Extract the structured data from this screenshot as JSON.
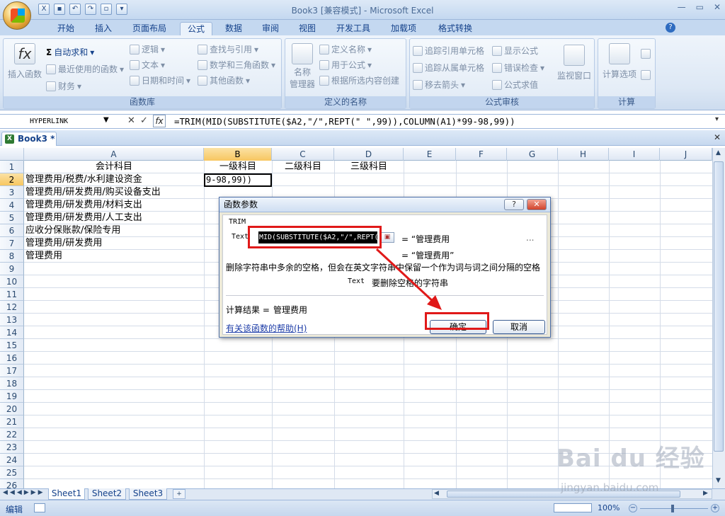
{
  "window": {
    "title": "Book3  [兼容模式] - Microsoft Excel",
    "controls": [
      "—",
      "▭",
      "✕"
    ]
  },
  "ribbon_tabs": [
    "开始",
    "插入",
    "页面布局",
    "公式",
    "数据",
    "审阅",
    "视图",
    "开发工具",
    "加载项",
    "格式转换"
  ],
  "active_tab": "公式",
  "groups": {
    "library": {
      "label": "函数库",
      "insert_function": "插入函数",
      "autosum": "自动求和",
      "recent": "最近使用的函数",
      "finance": "财务",
      "logic": "逻辑",
      "text": "文本",
      "datetime": "日期和时间",
      "lookup": "查找与引用",
      "math": "数学和三角函数",
      "other": "其他函数"
    },
    "names": {
      "label": "定义的名称",
      "manager_line1": "名称",
      "manager_line2": "管理器",
      "define_name": "定义名称",
      "use_in_formula": "用于公式",
      "create_from_selection": "根据所选内容创建"
    },
    "audit": {
      "label": "公式审核",
      "trace_precedents": "追踪引用单元格",
      "trace_dependents": "追踪从属单元格",
      "remove_arrows": "移去箭头",
      "show_formulas": "显示公式",
      "error_check": "错误检查",
      "evaluate": "公式求值",
      "watch_window": "监视窗口"
    },
    "calc": {
      "label": "计算",
      "options": "计算选项"
    }
  },
  "formula_bar": {
    "name_box": "HYPERLINK",
    "formula": "=TRIM(MID(SUBSTITUTE($A2,\"/\",REPT(\" \",99)),COLUMN(A1)*99-98,99))"
  },
  "workbook_tab": "Book3 *",
  "columns": [
    "A",
    "B",
    "C",
    "D",
    "E",
    "F",
    "G",
    "H",
    "I",
    "J"
  ],
  "rows": [
    "1",
    "2",
    "3",
    "4",
    "5",
    "6",
    "7",
    "8",
    "9",
    "10",
    "11",
    "12",
    "13",
    "14",
    "15",
    "16",
    "17",
    "18",
    "19",
    "20",
    "21",
    "22",
    "23",
    "24",
    "25",
    "26"
  ],
  "cells": {
    "A1": "会计科目",
    "B1": "一级科目",
    "C1": "二级科目",
    "D1": "三级科目",
    "A2": "管理费用/税费/水利建设资金",
    "A3": "管理费用/研发费用/购买设备支出",
    "A4": "管理费用/研发费用/材料支出",
    "A5": "管理费用/研发费用/人工支出",
    "A6": "应收分保账款/保险专用",
    "A7": "管理费用/研发费用",
    "A8": "管理费用"
  },
  "active_cell_text": "9-98,99))",
  "sheet_tabs": [
    "Sheet1",
    "Sheet2",
    "Sheet3"
  ],
  "status": {
    "mode": "编辑",
    "zoom": "100%"
  },
  "dialog": {
    "title": "函数参数",
    "function_name": "TRIM",
    "arg_label": "Text",
    "arg_value": "MID(SUBSTITUTE($A2,\"/\",REPT(\"",
    "arg_result": "= “管理费用",
    "arg_more": "...",
    "formula_result": "= “管理费用”",
    "description": "删除字符串中多余的空格，但会在英文字符串中保留一个作为词与词之间分隔的空格",
    "arg_desc_name": "Text",
    "arg_desc_text": "要删除空格的字符串",
    "calc_result_label": "计算结果 =",
    "calc_result_value": "管理费用",
    "help_link": "有关该函数的帮助(H)",
    "ok": "确定",
    "cancel": "取消",
    "help_btn": "?",
    "close_btn": "✕"
  },
  "watermark": {
    "main": "Bai du 经验",
    "sub": "jingyan.baidu.com"
  },
  "colors": {
    "accent": "#15428b",
    "highlight": "#e01919",
    "selected_header": "#f7c660"
  }
}
